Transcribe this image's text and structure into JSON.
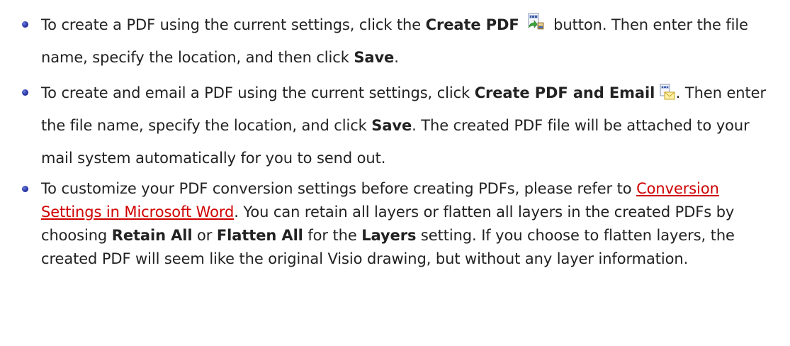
{
  "bullets": [
    {
      "t1": "To create a PDF using the current settings, click the ",
      "b1": "Create PDF",
      "icon": "create-pdf-icon",
      "t2": " button. Then enter the file name, specify the location, and then click ",
      "b2": "Save",
      "t3": "."
    },
    {
      "t1": "To create and email a PDF using the current settings, click ",
      "b1": "Create PDF and Email",
      "icon": "create-pdf-email-icon",
      "t2": ". Then enter the file name, specify the location, and click ",
      "b2": "Save",
      "t3": ". The created PDF file will be attached to your mail system automatically for you to send out."
    },
    {
      "t1": "To customize your PDF conversion settings before creating PDFs, please refer to ",
      "link": "Conversion Settings in Microsoft Word",
      "t2": ". You can retain all layers or flatten all layers in the created PDFs by choosing ",
      "b1": "Retain All",
      "t3": " or ",
      "b2": "Flatten All",
      "t4": " for the ",
      "b3": "Layers",
      "t5": " setting. If you choose to flatten layers, the created PDF will seem like the original Visio drawing, but without any layer information."
    }
  ],
  "colors": {
    "link": "#d00000",
    "bullet": "#2a35a8",
    "text": "#222222"
  }
}
